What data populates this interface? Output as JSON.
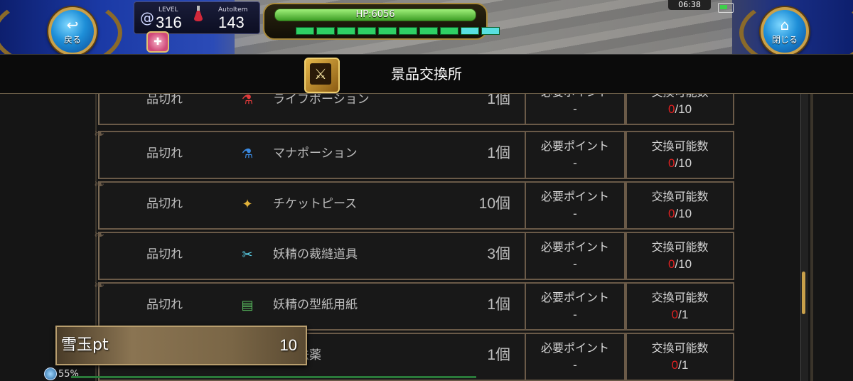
{
  "hud": {
    "back_label": "戻る",
    "close_label": "閉じる",
    "level_caption": "LEVEL",
    "level_value": "316",
    "autoitem_caption": "AutoItem",
    "autoitem_value": "143",
    "hp_text": "HP:6056",
    "clock": "06:38",
    "stamina_pips": 10
  },
  "page": {
    "title": "景品交換所"
  },
  "rows": [
    {
      "status": "品切れ",
      "name": "ライフポーション",
      "icon": "red-potion-icon",
      "qty": "1個",
      "required_label": "必要ポイント",
      "required_value": "-",
      "exchange_label": "交換可能数",
      "exchange_used": "0",
      "exchange_max": "/10"
    },
    {
      "status": "品切れ",
      "name": "マナポーション",
      "icon": "blue-potion-icon",
      "qty": "1個",
      "required_label": "必要ポイント",
      "required_value": "-",
      "exchange_label": "交換可能数",
      "exchange_used": "0",
      "exchange_max": "/10"
    },
    {
      "status": "品切れ",
      "name": "チケットピース",
      "icon": "ticket-piece-icon",
      "qty": "10個",
      "required_label": "必要ポイント",
      "required_value": "-",
      "exchange_label": "交換可能数",
      "exchange_used": "0",
      "exchange_max": "/10"
    },
    {
      "status": "品切れ",
      "name": "妖精の裁縫道具",
      "icon": "scissors-icon",
      "qty": "3個",
      "required_label": "必要ポイント",
      "required_value": "-",
      "exchange_label": "交換可能数",
      "exchange_used": "0",
      "exchange_max": "/10"
    },
    {
      "status": "品切れ",
      "name": "妖精の型紙用紙",
      "icon": "paper-icon",
      "qty": "1個",
      "required_label": "必要ポイント",
      "required_value": "-",
      "exchange_label": "交換可能数",
      "exchange_used": "0",
      "exchange_max": "/1"
    },
    {
      "status": "",
      "name": "の魔法薬",
      "icon": "magic-potion-icon",
      "qty": "1個",
      "required_label": "必要ポイント",
      "required_value": "-",
      "exchange_label": "交換可能数",
      "exchange_used": "0",
      "exchange_max": "/1"
    }
  ],
  "points": {
    "name": "雪玉pt",
    "value": "10"
  },
  "progress": {
    "percent_text": "55%"
  },
  "colors": {
    "exhausted_count": "#e02020",
    "frame_border": "#6a5a48",
    "hp_bar": "#4fc030"
  }
}
